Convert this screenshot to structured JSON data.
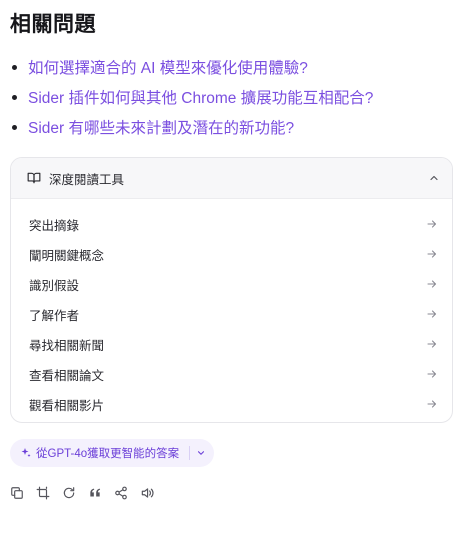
{
  "section": {
    "title": "相關問題"
  },
  "related_questions": [
    "如何選擇適合的 AI 模型來優化使用體驗?",
    "Sider 插件如何與其他 Chrome 擴展功能互相配合?",
    "Sider 有哪些未來計劃及潛在的新功能?"
  ],
  "reading_tools": {
    "header": "深度閱讀工具",
    "header_icon": "book-open-icon",
    "collapse_icon": "chevron-up-icon",
    "items": [
      "突出摘錄",
      "闡明關鍵概念",
      "識別假設",
      "了解作者",
      "尋找相關新聞",
      "查看相關論文",
      "觀看相關影片"
    ],
    "item_icon": "arrow-right-icon"
  },
  "upgrade": {
    "label": "從GPT-4o獲取更智能的答案",
    "icon": "sparkle-icon",
    "dropdown_icon": "chevron-down-icon"
  },
  "actions": {
    "icons": [
      "copy-icon",
      "crop-icon",
      "refresh-icon",
      "quote-icon",
      "share-icon",
      "speaker-icon"
    ]
  },
  "colors": {
    "accent": "#7b4fe0",
    "text": "#2a2a30",
    "muted_icon": "#8a8a93"
  }
}
